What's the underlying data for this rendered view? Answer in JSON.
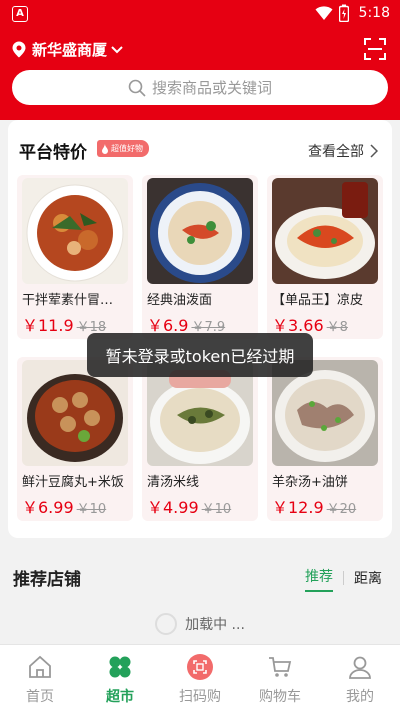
{
  "status_bar": {
    "time": "5:18",
    "app_badge": "A"
  },
  "header": {
    "location": "新华盛商厦",
    "search_placeholder": "搜索商品或关键词"
  },
  "deals": {
    "title": "平台特价",
    "tag": "超值好物",
    "view_all": "查看全部",
    "products": [
      {
        "name": "干拌荤素什冒…",
        "price": "￥11.9",
        "old_price": "￥18"
      },
      {
        "name": "经典油泼面",
        "price": "￥6.9",
        "old_price": "￥7.9"
      },
      {
        "name": "【单品王】凉皮",
        "price": "￥3.66",
        "old_price": "￥8"
      },
      {
        "name": "鲜汁豆腐丸+米饭",
        "price": "￥6.99",
        "old_price": "￥10"
      },
      {
        "name": "清汤米线",
        "price": "￥4.99",
        "old_price": "￥10"
      },
      {
        "name": "羊杂汤+油饼",
        "price": "￥12.9",
        "old_price": "￥20"
      }
    ]
  },
  "toast": "暂未登录或token已经过期",
  "recommend": {
    "title": "推荐店铺",
    "tabs": [
      "推荐",
      "距离"
    ],
    "loading": "加载中 ..."
  },
  "tabbar": {
    "items": [
      {
        "label": "首页",
        "icon": "home-icon"
      },
      {
        "label": "超市",
        "icon": "clover-icon"
      },
      {
        "label": "扫码购",
        "icon": "scan-code-icon"
      },
      {
        "label": "购物车",
        "icon": "cart-icon"
      },
      {
        "label": "我的",
        "icon": "user-icon"
      }
    ],
    "active_index": 1
  },
  "colors": {
    "brand_red": "#e60012",
    "active_green": "#23a15a",
    "price_red": "#e60012"
  }
}
